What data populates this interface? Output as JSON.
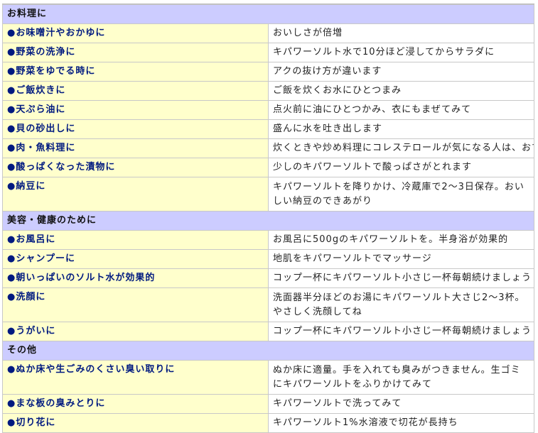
{
  "bullet": "●",
  "sections": [
    {
      "title": "お料理に",
      "rows": [
        {
          "label": "お味噌汁やおかゆに",
          "text": "おいしさが倍増"
        },
        {
          "label": "野菜の洗浄に",
          "text": "キパワーソルト水で10分ほど浸してからサラダに"
        },
        {
          "label": "野菜をゆでる時に",
          "text": "アクの抜け方が違います"
        },
        {
          "label": "ご飯炊きに",
          "text": "ご飯を炊くお水にひとつまみ"
        },
        {
          "label": "天ぷら油に",
          "text": "点火前に油にひとつかみ、衣にもまぜてみて"
        },
        {
          "label": "貝の砂出しに",
          "text": "盛んに水を吐き出します"
        },
        {
          "label": "肉・魚料理に",
          "text": "炊くときや炒め料理にコレステロールが気になる人は、おすすめ"
        },
        {
          "label": "酸っぱくなった漬物に",
          "text": "少しのキパワーソルトで酸っぱさがとれます"
        },
        {
          "label": "納豆に",
          "text": "キパワーソルトを降りかけ、冷蔵庫で2～3日保存。おいしい納豆のできあがり"
        }
      ]
    },
    {
      "title": "美容・健康のために",
      "rows": [
        {
          "label": "お風呂に",
          "text": "お風呂に500gのキパワーソルトを。半身浴が効果的"
        },
        {
          "label": "シャンプーに",
          "text": "地肌をキパワーソルトでマッサージ"
        },
        {
          "label": "朝いっぱいのソルト水が効果的",
          "text": "コップ一杯にキパワーソルト小さじ一杯毎朝続けましょう"
        },
        {
          "label": "洗顔に",
          "text": "洗面器半分ほどのお湯にキパワーソルト大さじ2～3杯。やさしく洗顔してね"
        },
        {
          "label": "うがいに",
          "text": "コップ一杯にキパワーソルト小さじ一杯毎朝続けましょう"
        }
      ]
    },
    {
      "title": "その他",
      "rows": [
        {
          "label": "ぬか床や生ごみのくさい臭い取りに",
          "text": "ぬか床に適量。手を入れても臭みがつきません。生ゴミにキパワーソルトをふりかけてみて"
        },
        {
          "label": "まな板の臭みとりに",
          "text": "キパワーソルトで洗ってみて"
        },
        {
          "label": "切り花に",
          "text": "キパワーソルト1%水溶液で切花が長持ち"
        }
      ]
    }
  ]
}
